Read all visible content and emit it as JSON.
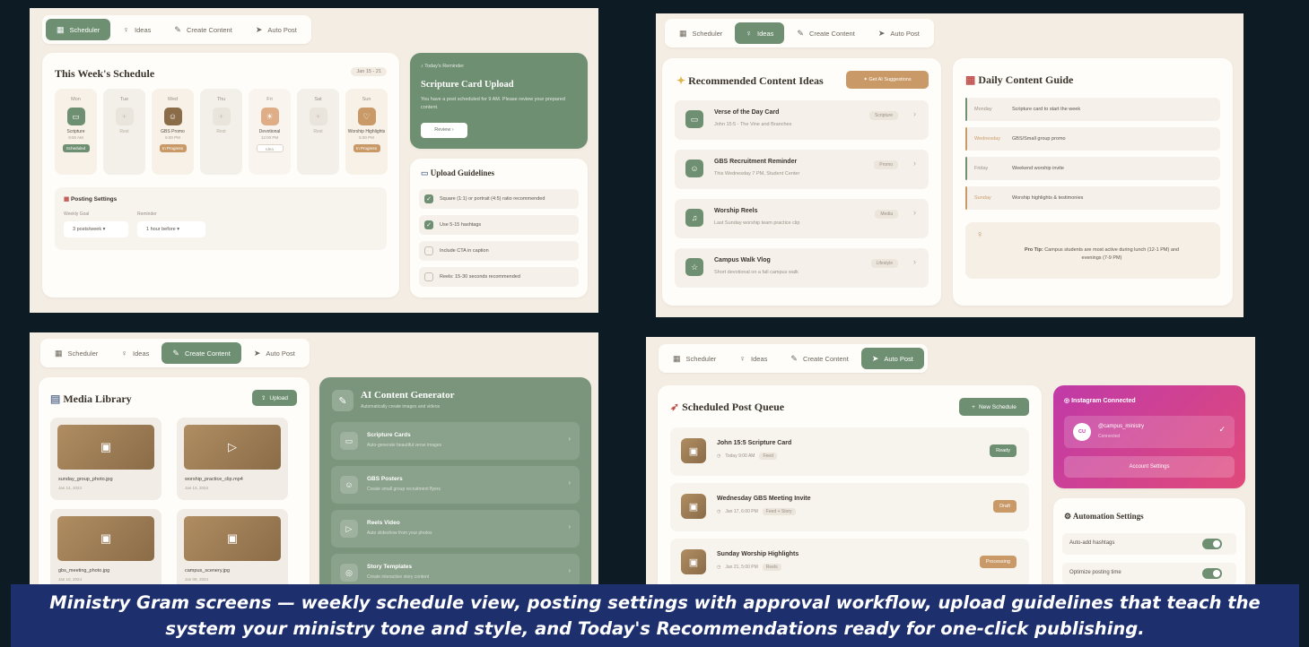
{
  "tabs": {
    "scheduler": "Scheduler",
    "ideas": "Ideas",
    "create": "Create Content",
    "autopost": "Auto Post"
  },
  "schedule": {
    "title": "This Week's Schedule",
    "date_range": "Jan 15 - 21",
    "days": [
      {
        "name": "Mon",
        "title": "Scripture",
        "time": "9:00 AM",
        "badge": "Scheduled",
        "state": "green"
      },
      {
        "name": "Tue",
        "title": "Rest",
        "state": "empty"
      },
      {
        "name": "Wed",
        "title": "GBS Promo",
        "time": "6:00 PM",
        "badge": "In Progress",
        "state": "brown"
      },
      {
        "name": "Thu",
        "title": "Rest",
        "state": "empty"
      },
      {
        "name": "Fri",
        "title": "Devotional",
        "time": "12:00 PM",
        "badge": "Idea",
        "state": "light"
      },
      {
        "name": "Sat",
        "title": "Rest",
        "state": "empty"
      },
      {
        "name": "Sun",
        "title": "Worship Highlights",
        "time": "5:00 PM",
        "badge": "In Progress",
        "state": "tan"
      }
    ],
    "posting": {
      "title": "Posting Settings",
      "weekly_goal_label": "Weekly Goal",
      "weekly_goal_value": "3 posts/week",
      "reminder_label": "Reminder",
      "reminder_value": "1 hour before"
    }
  },
  "reminder": {
    "label": "Today's Reminder",
    "title": "Scripture Card Upload",
    "text": "You have a post scheduled for 9 AM. Please review your prepared content.",
    "button": "Review"
  },
  "upload_guidelines": {
    "title": "Upload Guidelines",
    "items": [
      {
        "text": "Square (1:1) or portrait (4:5) ratio recommended",
        "checked": true
      },
      {
        "text": "Use 5-15 hashtags",
        "checked": true
      },
      {
        "text": "Include CTA in caption",
        "checked": false
      },
      {
        "text": "Reels: 15-30 seconds recommended",
        "checked": false
      }
    ]
  },
  "ideas": {
    "title": "Recommended Content Ideas",
    "ai_button": "Get AI Suggestions",
    "items": [
      {
        "title": "Verse of the Day Card",
        "sub": "John 15:5 - The Vine and Branches",
        "tag": "Scripture",
        "icon": "book-icon"
      },
      {
        "title": "GBS Recruitment Reminder",
        "sub": "This Wednesday 7 PM, Student Center",
        "tag": "Promo",
        "icon": "people-icon"
      },
      {
        "title": "Worship Reels",
        "sub": "Last Sunday worship team practice clip",
        "tag": "Media",
        "icon": "music-icon"
      },
      {
        "title": "Campus Walk Vlog",
        "sub": "Short devotional on a fall campus walk",
        "tag": "Lifestyle",
        "icon": "star-icon"
      }
    ]
  },
  "daily_guide": {
    "title": "Daily Content Guide",
    "rows": [
      {
        "day": "Monday",
        "text": "Scripture card to start the week",
        "color": "#6f8f72"
      },
      {
        "day": "Wednesday",
        "text": "GBS/Small group promo",
        "color": "#c99a68"
      },
      {
        "day": "Friday",
        "text": "Weekend worship invite",
        "color": "#6f8f72"
      },
      {
        "day": "Sunday",
        "text": "Worship highlights & testimonies",
        "color": "#c99a68"
      }
    ],
    "tip_label": "Pro Tip:",
    "tip_text": "Campus students are most active during lunch (12-1 PM) and evenings (7-9 PM)"
  },
  "media": {
    "title": "Media Library",
    "upload_button": "Upload",
    "items": [
      {
        "name": "sunday_group_photo.jpg",
        "date": "Jan 14, 2024",
        "icon": "image-icon"
      },
      {
        "name": "worship_practice_clip.mp4",
        "date": "Jan 13, 2024",
        "icon": "play-icon"
      },
      {
        "name": "gbs_meeting_photo.jpg",
        "date": "Jan 10, 2024",
        "icon": "image-icon"
      },
      {
        "name": "campus_scenery.jpg",
        "date": "Jan 08, 2024",
        "icon": "image-icon"
      }
    ]
  },
  "generator": {
    "title": "AI Content Generator",
    "sub": "Automatically create images and videos",
    "items": [
      {
        "title": "Scripture Cards",
        "sub": "Auto-generate beautiful verse images",
        "icon": "book-icon"
      },
      {
        "title": "GBS Posters",
        "sub": "Create small group recruitment flyers",
        "icon": "people-icon"
      },
      {
        "title": "Reels Video",
        "sub": "Auto slideshow from your photos",
        "icon": "play-icon"
      },
      {
        "title": "Story Templates",
        "sub": "Create interactive story content",
        "icon": "instagram-icon"
      }
    ]
  },
  "queue": {
    "title": "Scheduled Post Queue",
    "new_button": "New Schedule",
    "items": [
      {
        "title": "John 15:5 Scripture Card",
        "time": "Today 9:00 AM",
        "tag": "Feed",
        "status": "Ready",
        "status_color": "#6f8f72"
      },
      {
        "title": "Wednesday GBS Meeting Invite",
        "time": "Jan 17, 6:00 PM",
        "tag": "Feed + Story",
        "status": "Draft",
        "status_color": "#c99a68"
      },
      {
        "title": "Sunday Worship Highlights",
        "time": "Jan 21, 5:00 PM",
        "tag": "Reels",
        "status": "Processing",
        "status_color": "#c99a68"
      }
    ]
  },
  "instagram": {
    "title": "Instagram Connected",
    "initials": "CU",
    "handle": "@campus_ministry",
    "status": "Connected",
    "button": "Account Settings"
  },
  "automation": {
    "title": "Automation Settings",
    "items": [
      {
        "label": "Auto-add hashtags",
        "on": true
      },
      {
        "label": "Optimize posting time",
        "on": true
      }
    ]
  },
  "caption": {
    "line1": "Ministry Gram screens — weekly schedule view, posting settings with approval workflow, upload guidelines that teach the",
    "line2": "system your ministry tone and style, and Today's Recommendations ready for one-click publishing."
  }
}
